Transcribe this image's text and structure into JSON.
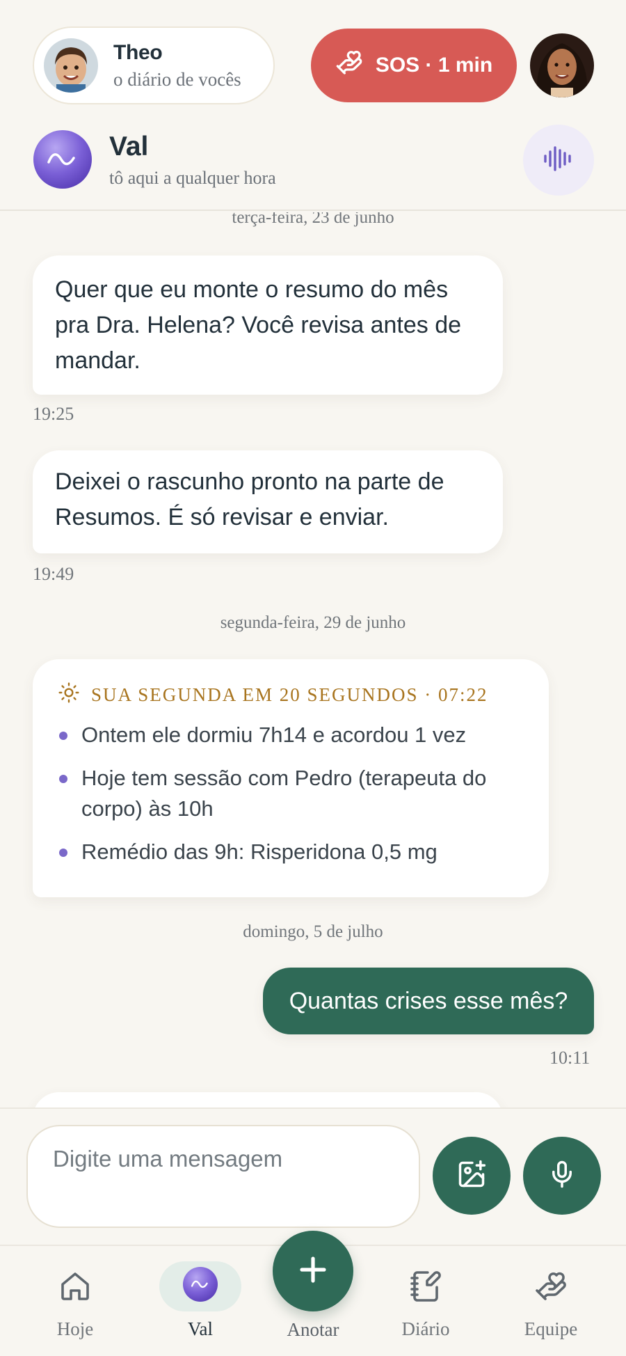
{
  "header": {
    "child_name": "Theo",
    "child_subtitle": "o diário de vocês",
    "sos_label": "SOS · 1 min"
  },
  "assistant": {
    "name": "Val",
    "subtitle": "tô aqui a qualquer hora"
  },
  "chat": {
    "date_top": "terça-feira, 23 de junho",
    "messages": [
      {
        "text": "Quer que eu monte o resumo do mês pra Dra. Helena? Você revisa antes de mandar.",
        "time": "19:25"
      },
      {
        "text": "Deixei o rascunho pronto na parte de Resumos. É só revisar e enviar.",
        "time": "19:49"
      }
    ],
    "date_2": "segunda-feira, 29 de junho",
    "summary": {
      "title": "SUA SEGUNDA EM 20 SEGUNDOS · 07:22",
      "items": [
        "Ontem ele dormiu 7h14 e acordou 1 vez",
        "Hoje tem sessão com Pedro (terapeuta do corpo) às 10h",
        "Remédio das 9h: Risperidona 0,5 mg"
      ]
    },
    "date_3": "domingo, 5 de julho",
    "outgoing": {
      "text": "Quantas crises esse mês?",
      "time": "10:11"
    }
  },
  "composer": {
    "placeholder": "Digite uma mensagem"
  },
  "nav": {
    "items": [
      {
        "label": "Hoje"
      },
      {
        "label": "Val"
      },
      {
        "label": "Anotar"
      },
      {
        "label": "Diário"
      },
      {
        "label": "Equipe"
      }
    ]
  },
  "colors": {
    "background": "#f8f6f1",
    "primary_green": "#2f6a57",
    "sos_red": "#d75a55",
    "accent_purple": "#7a68c9",
    "summary_gold": "#a8741e"
  },
  "icons": {
    "sos": "hand-heart-icon",
    "voice": "waveform-icon",
    "photo": "image-add-icon",
    "mic": "microphone-icon",
    "home": "home-icon",
    "add": "plus-icon",
    "diary": "notebook-pen-icon",
    "team": "hand-heart-icon"
  }
}
